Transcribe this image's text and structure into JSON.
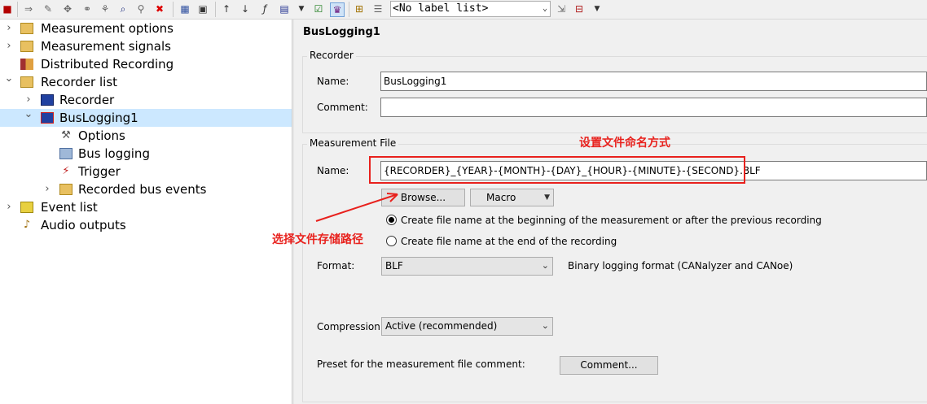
{
  "toolbar": {
    "label_list_value": "<No label list>"
  },
  "tree": {
    "items": [
      {
        "label": "Measurement options",
        "expander": "›"
      },
      {
        "label": "Measurement signals",
        "expander": "›"
      },
      {
        "label": "Distributed Recording",
        "expander": ""
      },
      {
        "label": "Recorder list",
        "expander": "⌄"
      },
      {
        "label": "Recorder",
        "expander": "›"
      },
      {
        "label": "BusLogging1",
        "expander": "⌄"
      },
      {
        "label": "Options",
        "expander": ""
      },
      {
        "label": "Bus logging",
        "expander": ""
      },
      {
        "label": "Trigger",
        "expander": ""
      },
      {
        "label": "Recorded bus events",
        "expander": "›"
      },
      {
        "label": "Event list",
        "expander": "›"
      },
      {
        "label": "Audio outputs",
        "expander": ""
      }
    ]
  },
  "panel": {
    "title": "BusLogging1",
    "recorder_group": {
      "title": "Recorder",
      "name_label": "Name:",
      "name_value": "BusLogging1",
      "comment_label": "Comment:",
      "comment_value": ""
    },
    "measurement_group": {
      "title": "Measurement File",
      "name_label": "Name:",
      "name_value": "{RECORDER}_{YEAR}-{MONTH}-{DAY}_{HOUR}-{MINUTE}-{SECOND}.BLF",
      "browse_label": "Browse...",
      "macro_label": "Macro",
      "radio1_label": "Create file name at the beginning of the measurement or after the previous recording",
      "radio2_label": "Create file name at the end of the recording",
      "radio_selected": 1,
      "format_label": "Format:",
      "format_value": "BLF",
      "format_desc": "Binary logging format (CANalyzer and CANoe)",
      "compression_label": "Compression:",
      "compression_value": "Active (recommended)",
      "preset_label": "Preset for the measurement file comment:",
      "comment_button_label": "Comment..."
    }
  },
  "annotations": {
    "naming": "设置文件命名方式",
    "path": "选择文件存储路径",
    "color": "#e8211d"
  }
}
